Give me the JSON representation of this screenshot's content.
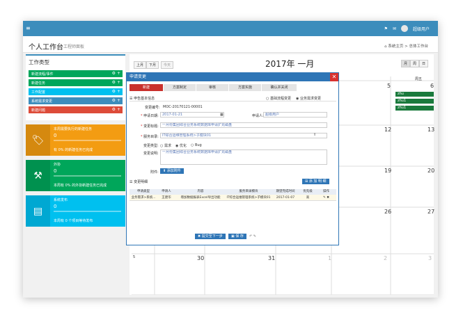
{
  "topbar": {
    "menu_icon": "≡",
    "user_name": "超级用户"
  },
  "header": {
    "title": "个人工作台",
    "subtitle": "工程师面板",
    "crumb_home": "系统主页",
    "crumb_current": "总体工作台"
  },
  "left": {
    "work_type_title": "工作类型",
    "types": [
      {
        "label": "新建流程/事件",
        "color": "#00a65a"
      },
      {
        "label": "新建任务",
        "color": "#00a65a"
      },
      {
        "label": "工作配置",
        "color": "#00c0ef"
      },
      {
        "label": "系统需求变更",
        "color": "#3c8dbc"
      },
      {
        "label": "新建问题",
        "color": "#dd4b39"
      }
    ],
    "stats": [
      {
        "line1": "本周需要执行的新建任务",
        "value": "0",
        "line3": "有 0% 的新建任务已完成",
        "color": "#f39c12",
        "icon": "tag-icon"
      },
      {
        "line1": "外协",
        "value": "0",
        "line3": "本周有 0% 的外协新建任务已完成",
        "color": "#00a65a",
        "icon": "tools-icon"
      },
      {
        "line1": "系统发布",
        "value": "0",
        "line3": "本周有 0 个项目等待发布",
        "color": "#00c0ef",
        "icon": "document-icon"
      }
    ]
  },
  "calendar": {
    "prev": "上月",
    "next": "下月",
    "today": "今天",
    "month_title": "2017年 一月",
    "view_month": "月",
    "view_week": "周",
    "view_day": "日",
    "visible_weekday": "周五",
    "days": [
      "5",
      "6",
      "12",
      "13",
      "19",
      "20",
      "26",
      "27",
      "30",
      "31",
      "5"
    ],
    "events": [
      "zhu",
      "zhu1",
      "zhu1"
    ]
  },
  "modal": {
    "title": "申请变更",
    "steps": [
      "新建",
      "方案制定",
      "审核",
      "方案实施",
      "确认并关闭"
    ],
    "section_basic": "申告基本信息",
    "radio_normal": "基础流程变更",
    "radio_urgent": "业务需求变更",
    "fields": {
      "change_no_label": "变更编号:",
      "change_no": "MOC-20170121-00001",
      "apply_date_label": "申请日期:",
      "apply_date": "2017-01-21",
      "applicant_label": "申请人:",
      "applicant": "超级用户",
      "subject_label": "变更标题:",
      "subject": "一月份集团综合业务系统数据库申请扩充磁盘",
      "service_label": "服务目录:",
      "service": "IT综合运维管理系统>子模块01",
      "type_label": "变更类型:",
      "type_opt1": "需求",
      "type_opt2": "优化",
      "type_opt3": "Bug",
      "desc_label": "变更说明:",
      "desc": "一月份集团综合业务系统数据库申请扩充磁盘",
      "attach_label": "附件:",
      "attach_btn": "添加附件"
    },
    "section_detail": "变更明细",
    "add_detail_btn": "添 加 明 细",
    "table": {
      "headers": [
        "申请类型",
        "申请人",
        "内容",
        "服务目录模块",
        "期望完成时间",
        "优先级",
        "操作"
      ],
      "rows": [
        [
          "业务需求>系统...",
          "王建华",
          "增加数据报表Excel导出功能",
          "IT综合运维管理系统>子模块01",
          "2017-01-07",
          "高",
          "✎ ✖"
        ]
      ]
    },
    "submit_btn": "提交至下一步",
    "save_btn": "保 存"
  }
}
